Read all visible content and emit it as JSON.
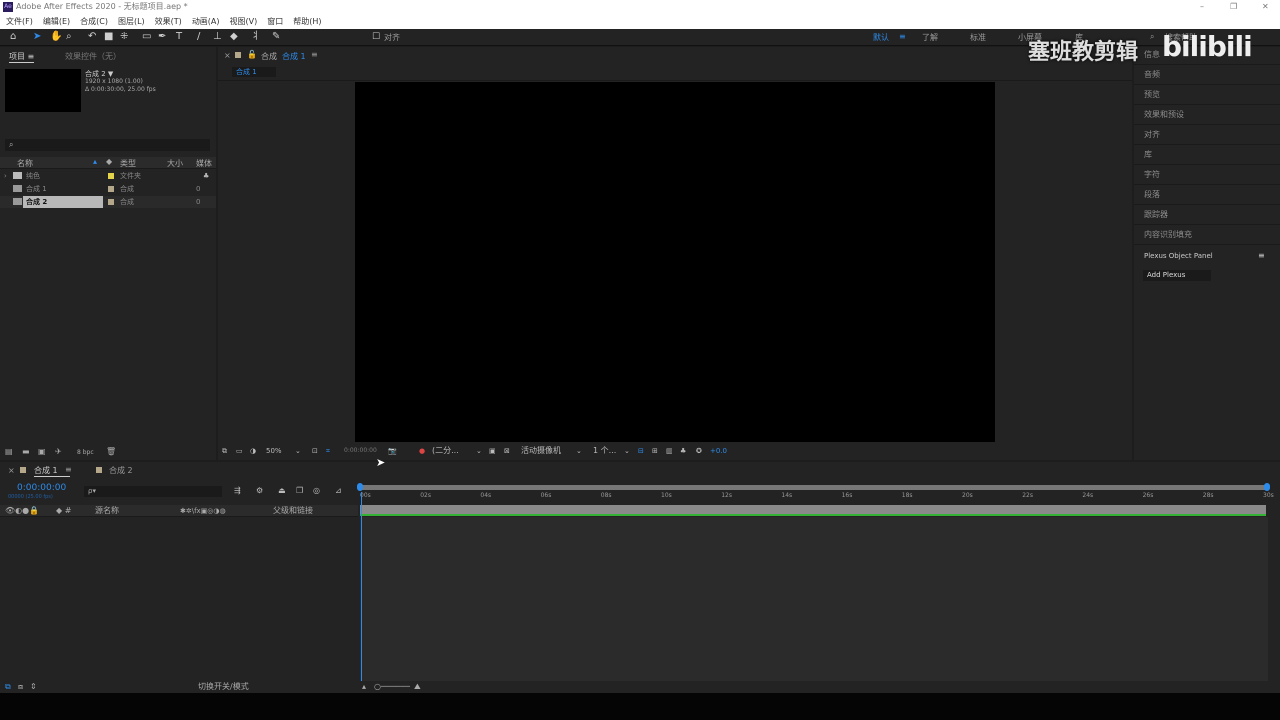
{
  "title": {
    "app_icon": "Ae",
    "text": "Adobe After Effects 2020 - 无标题项目.aep *"
  },
  "window_controls": {
    "minimize": "–",
    "restore": "❐",
    "close": "✕"
  },
  "menu": [
    "文件(F)",
    "编辑(E)",
    "合成(C)",
    "图层(L)",
    "效果(T)",
    "动画(A)",
    "视图(V)",
    "窗口",
    "帮助(H)"
  ],
  "toolbar": {
    "snap_label": "对齐",
    "workspaces": [
      "默认",
      "了解",
      "标准",
      "小屏幕",
      "库"
    ],
    "search_placeholder": "搜索帮助"
  },
  "watermark": {
    "text": "塞班教剪辑",
    "logo": "bilibili"
  },
  "project": {
    "tab": "项目",
    "effects_tab": "效果控件（无）",
    "preview_name": "合成 2 ▼",
    "preview_res": "1920 x 1080 (1.00)",
    "preview_dur": "Δ 0:00:30:00, 25.00 fps",
    "columns": [
      "名称",
      "类型",
      "大小",
      "媒体"
    ],
    "items": [
      {
        "name": "纯色",
        "type": "文件夹",
        "size": "",
        "color": "#e3d34a"
      },
      {
        "name": "合成 1",
        "type": "合成",
        "size": "0",
        "color": "#b5a88a"
      },
      {
        "name": "合成 2",
        "type": "合成",
        "size": "0",
        "color": "#b5a88a"
      }
    ],
    "bpc": "8 bpc"
  },
  "comp": {
    "tab_prefix": "合成",
    "tab_name": "合成 1",
    "breadcrumb": "合成 1",
    "zoom": "50%",
    "timecode": "0:00:00:00",
    "resolution": "(二分...",
    "camera": "活动摄像机",
    "views": "1 个...",
    "exposure": "+0.0"
  },
  "right_panel": {
    "items": [
      "信息",
      "音频",
      "预览",
      "效果和预设",
      "对齐",
      "库",
      "字符",
      "段落",
      "跟踪器",
      "内容识别填充"
    ],
    "plexus_title": "Plexus Object Panel",
    "plexus_button": "Add Plexus"
  },
  "timeline": {
    "tabs": [
      "合成 1",
      "合成 2"
    ],
    "timecode": "0:00:00:00",
    "frames": "00000 (25.00 fps)",
    "search_placeholder": "ρ▾",
    "source_name": "源名称",
    "parent_label": "父级和链接",
    "ruler": [
      "00s",
      "02s",
      "04s",
      "06s",
      "08s",
      "10s",
      "12s",
      "14s",
      "16s",
      "18s",
      "20s",
      "22s",
      "24s",
      "26s",
      "28s",
      "30s"
    ],
    "toggle_label": "切换开关/模式"
  }
}
